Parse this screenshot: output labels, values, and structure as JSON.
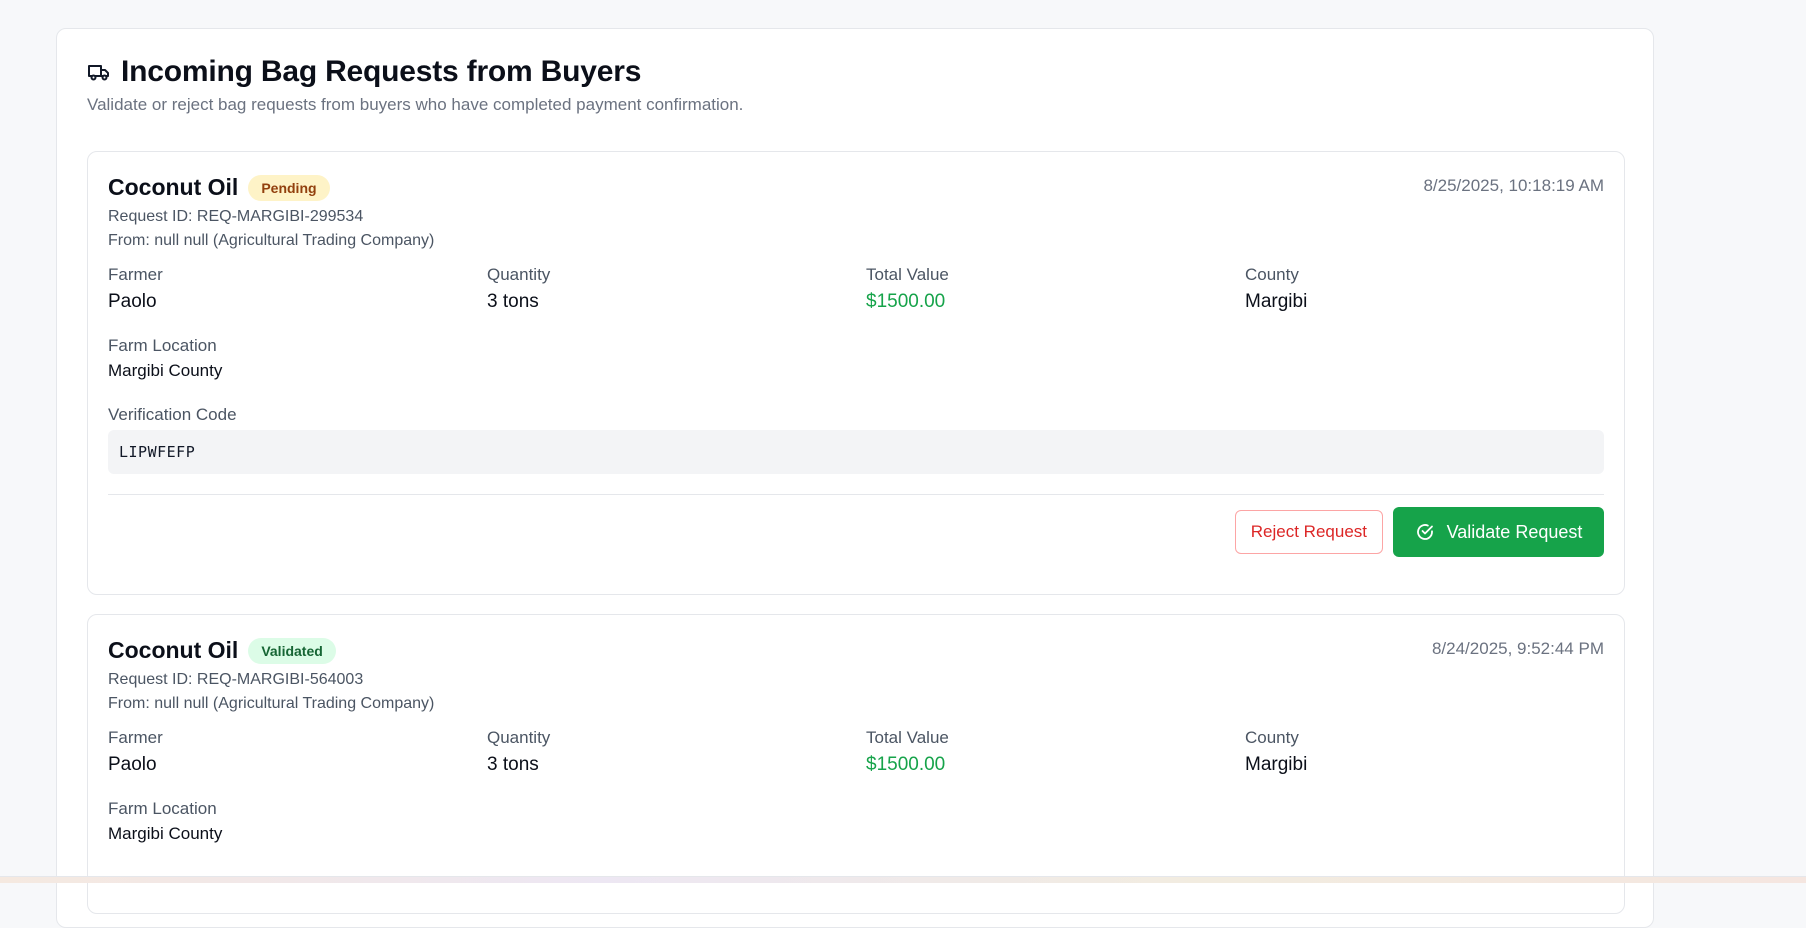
{
  "header": {
    "title": "Incoming Bag Requests from Buyers",
    "subtitle": "Validate or reject bag requests from buyers who have completed payment confirmation.",
    "icon": "truck-icon"
  },
  "labels": {
    "farmer": "Farmer",
    "quantity": "Quantity",
    "total_value": "Total Value",
    "county": "County",
    "farm_location": "Farm Location",
    "verification_code": "Verification Code"
  },
  "requests": [
    {
      "product": "Coconut Oil",
      "status": "Pending",
      "timestamp": "8/25/2025, 10:18:19 AM",
      "request_id": "Request ID: REQ-MARGIBI-299534",
      "from": "From: null null (Agricultural Trading Company)",
      "farmer": "Paolo",
      "quantity": "3 tons",
      "total_value": "$1500.00",
      "county": "Margibi",
      "farm_location": "Margibi County",
      "verification_code": "LIPWFEFP",
      "reject_label": "Reject Request",
      "validate_label": "Validate Request"
    },
    {
      "product": "Coconut Oil",
      "status": "Validated",
      "timestamp": "8/24/2025, 9:52:44 PM",
      "request_id": "Request ID: REQ-MARGIBI-564003",
      "from": "From: null null (Agricultural Trading Company)",
      "farmer": "Paolo",
      "quantity": "3 tons",
      "total_value": "$1500.00",
      "county": "Margibi",
      "farm_location": "Margibi County"
    }
  ],
  "colors": {
    "accent_green": "#16a34a",
    "reject_red": "#dc2626",
    "pending_badge_bg": "#fef3c7",
    "validated_badge_bg": "#dcfce7"
  }
}
